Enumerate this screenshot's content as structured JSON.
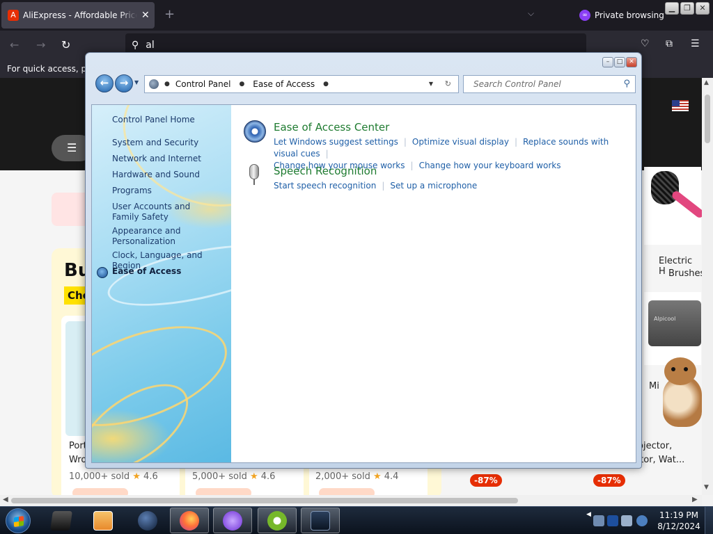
{
  "browser": {
    "tab": {
      "title": "AliExpress - Affordable Prices on",
      "close": "✕"
    },
    "new_tab": "+",
    "tab_list": "⌵",
    "private_label": "Private browsing",
    "window_buttons": {
      "minimize": "▁",
      "maximize": "❐",
      "close": "✕"
    },
    "nav": {
      "back": "←",
      "forward": "→",
      "reload": "↻"
    },
    "url": "al",
    "bookmarks_hint": "For quick access, plac",
    "toolbar_icons": [
      "pocket-icon",
      "extensions-icon",
      "menu-icon"
    ]
  },
  "page": {
    "menu_glyph": "☰",
    "banner_text": "Bu",
    "choice_text": "Cho",
    "products": [
      {
        "title": "Port",
        "title2": "Wro",
        "sold": "10,000+ sold",
        "rating": "4.6"
      },
      {
        "sold": "5,000+ sold",
        "rating": "4.6"
      },
      {
        "sold": "2,000+ sold",
        "rating": "4.4"
      }
    ],
    "side_products": [
      {
        "title": "Electric H",
        "title2": "Brushes"
      },
      {
        "title": "Mi"
      },
      {
        "title": "ojector,",
        "title2": "ector, Wat..."
      }
    ],
    "discount_badges": [
      "-87%",
      "-87%"
    ],
    "brand_on_cooler": "Alpicool"
  },
  "control_panel": {
    "caption_buttons": {
      "minimize": "–",
      "maximize": "□",
      "close": "✕"
    },
    "breadcrumb": [
      "Control Panel",
      "Ease of Access"
    ],
    "search_placeholder": "Search Control Panel",
    "sidebar": {
      "items": [
        "Control Panel Home",
        "System and Security",
        "Network and Internet",
        "Hardware and Sound",
        "Programs",
        "User Accounts and Family Safety",
        "Appearance and Personalization",
        "Clock, Language, and Region",
        "Ease of Access"
      ],
      "current_index": 8
    },
    "categories": [
      {
        "title": "Ease of Access Center",
        "icon": "ease-of-access-icon",
        "links": [
          "Let Windows suggest settings",
          "Optimize visual display",
          "Replace sounds with visual cues",
          "Change how your mouse works",
          "Change how your keyboard works"
        ]
      },
      {
        "title": "Speech Recognition",
        "icon": "microphone-icon",
        "links": [
          "Start speech recognition",
          "Set up a microphone"
        ]
      }
    ]
  },
  "taskbar": {
    "clock_time": "11:19 PM",
    "clock_date": "8/12/2024",
    "apps": [
      "media-center-icon",
      "media-player-icon",
      "network-globe-icon",
      "firefox-icon",
      "private-browsing-icon",
      "utorrent-icon",
      "remote-desktop-icon"
    ],
    "active_apps": [
      3,
      4,
      5,
      6
    ]
  },
  "colors": {
    "link_blue": "#1f5fa7",
    "category_green": "#1e7b30",
    "aliexpress_red": "#e62e04",
    "private_purple": "#8a3ff5"
  }
}
